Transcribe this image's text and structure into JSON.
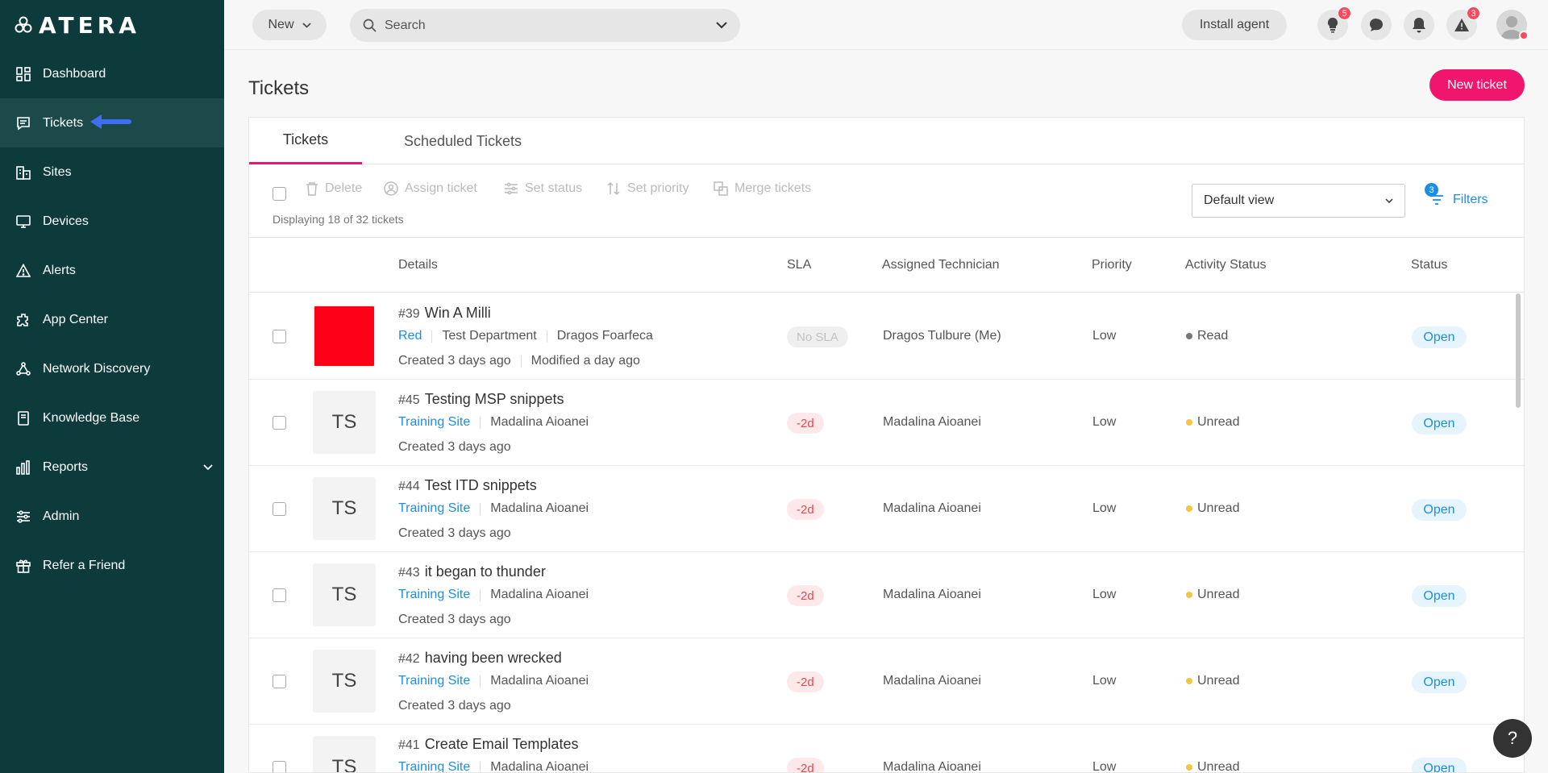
{
  "app": {
    "logo_text": "ATERA"
  },
  "sidebar": {
    "items": [
      {
        "label": "Dashboard",
        "icon": "dashboard-icon"
      },
      {
        "label": "Tickets",
        "icon": "tickets-icon",
        "active": true
      },
      {
        "label": "Sites",
        "icon": "sites-icon"
      },
      {
        "label": "Devices",
        "icon": "devices-icon"
      },
      {
        "label": "Alerts",
        "icon": "alerts-icon"
      },
      {
        "label": "App Center",
        "icon": "app-center-icon"
      },
      {
        "label": "Network Discovery",
        "icon": "network-discovery-icon"
      },
      {
        "label": "Knowledge Base",
        "icon": "knowledge-base-icon"
      },
      {
        "label": "Reports",
        "icon": "reports-icon",
        "expandable": true
      },
      {
        "label": "Admin",
        "icon": "admin-icon"
      },
      {
        "label": "Refer a Friend",
        "icon": "gift-icon"
      }
    ]
  },
  "topbar": {
    "new_label": "New",
    "search_placeholder": "Search",
    "install_label": "Install agent",
    "tips_badge": "5",
    "alerts_badge": "3"
  },
  "page": {
    "title": "Tickets",
    "new_ticket_label": "New ticket"
  },
  "tabs": [
    "Tickets",
    "Scheduled Tickets"
  ],
  "toolbar": {
    "delete": "Delete",
    "assign": "Assign ticket",
    "set_status": "Set status",
    "set_priority": "Set priority",
    "merge": "Merge tickets",
    "displaying": "Displaying 18 of 32 tickets",
    "view": "Default view",
    "filters_label": "Filters",
    "filters_count": "3"
  },
  "table": {
    "headers": [
      "Details",
      "SLA",
      "Assigned Technician",
      "Priority",
      "Activity Status",
      "Status"
    ],
    "rows": [
      {
        "thumb": "",
        "thumb_red": true,
        "num": "#39",
        "title": "Win A Milli",
        "site": "Red",
        "dept": "Test Department",
        "contact": "Dragos Foarfeca",
        "created": "Created 3 days ago",
        "modified": "Modified a day ago",
        "sla": "No SLA",
        "technician": "Dragos Tulbure (Me)",
        "priority": "Low",
        "activity": "Read",
        "status": "Open"
      },
      {
        "thumb": "TS",
        "num": "#45",
        "title": "Testing MSP snippets",
        "site": "Training Site",
        "contact": "Madalina Aioanei",
        "created": "Created 3 days ago",
        "sla": "-2d",
        "technician": "Madalina Aioanei",
        "priority": "Low",
        "activity": "Unread",
        "status": "Open"
      },
      {
        "thumb": "TS",
        "num": "#44",
        "title": "Test ITD snippets",
        "site": "Training Site",
        "contact": "Madalina Aioanei",
        "created": "Created 3 days ago",
        "sla": "-2d",
        "technician": "Madalina Aioanei",
        "priority": "Low",
        "activity": "Unread",
        "status": "Open"
      },
      {
        "thumb": "TS",
        "num": "#43",
        "title": "it began to thunder",
        "site": "Training Site",
        "contact": "Madalina Aioanei",
        "created": "Created 3 days ago",
        "sla": "-2d",
        "technician": "Madalina Aioanei",
        "priority": "Low",
        "activity": "Unread",
        "status": "Open"
      },
      {
        "thumb": "TS",
        "num": "#42",
        "title": "having been wrecked",
        "site": "Training Site",
        "contact": "Madalina Aioanei",
        "created": "Created 3 days ago",
        "sla": "-2d",
        "technician": "Madalina Aioanei",
        "priority": "Low",
        "activity": "Unread",
        "status": "Open"
      },
      {
        "thumb": "TS",
        "num": "#41",
        "title": "Create Email Templates",
        "site": "Training Site",
        "contact": "Madalina Aioanei",
        "created": "",
        "sla": "-2d",
        "technician": "Madalina Aioanei",
        "priority": "Low",
        "activity": "Unread",
        "status": "Open"
      }
    ]
  },
  "help_label": "?",
  "colors": {
    "sidebar_bg": "#0d3b3b",
    "accent": "#f0166d",
    "link": "#1a8fe3",
    "unread_dot": "#f5c542",
    "read_dot": "#777777"
  }
}
